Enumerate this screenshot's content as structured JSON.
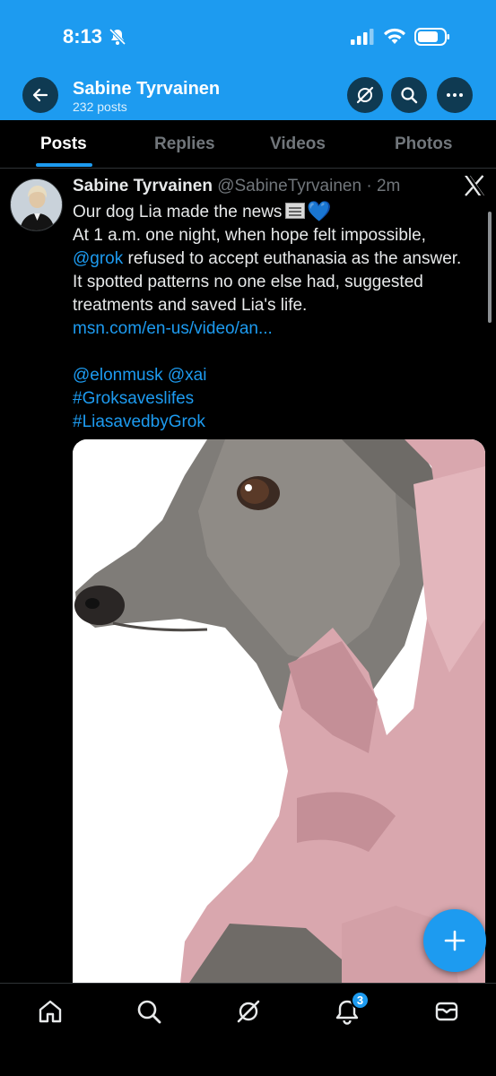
{
  "status_bar": {
    "time": "8:13"
  },
  "header": {
    "profile_name": "Sabine Tyrvainen",
    "post_count": "232 posts"
  },
  "tabs": [
    {
      "label": "Posts",
      "active": true
    },
    {
      "label": "Replies",
      "active": false
    },
    {
      "label": "Videos",
      "active": false
    },
    {
      "label": "Photos",
      "active": false
    }
  ],
  "post": {
    "author": "Sabine Tyrvainen",
    "handle": "@SabineTyrvainen",
    "separator": " · ",
    "time": "2m",
    "line1": "Our dog Lia made the news",
    "line2": "At 1 a.m. one night, when hope felt impossible,",
    "mention_grok": "@grok",
    "line3_rest": " refused to accept euthanasia as the answer.",
    "line4": "It spotted patterns no one else had, suggested",
    "line5": "treatments and saved Lia's life.",
    "link": "msn.com/en-us/video/an...",
    "mention_elon": "@elonmusk",
    "mention_xai": "@xai",
    "hashtag1": "#Groksaveslifes",
    "hashtag2": "#LiasavedbyGrok"
  },
  "bottom_nav": {
    "notification_count": "3",
    "icons": [
      "home-icon",
      "search-icon",
      "grok-icon",
      "bell-icon",
      "mail-icon"
    ]
  },
  "colors": {
    "accent": "#1d9bf0",
    "background": "#000000",
    "text": "#e7e9ea",
    "muted": "#71767b",
    "hoodie": "#d9a7ae"
  }
}
